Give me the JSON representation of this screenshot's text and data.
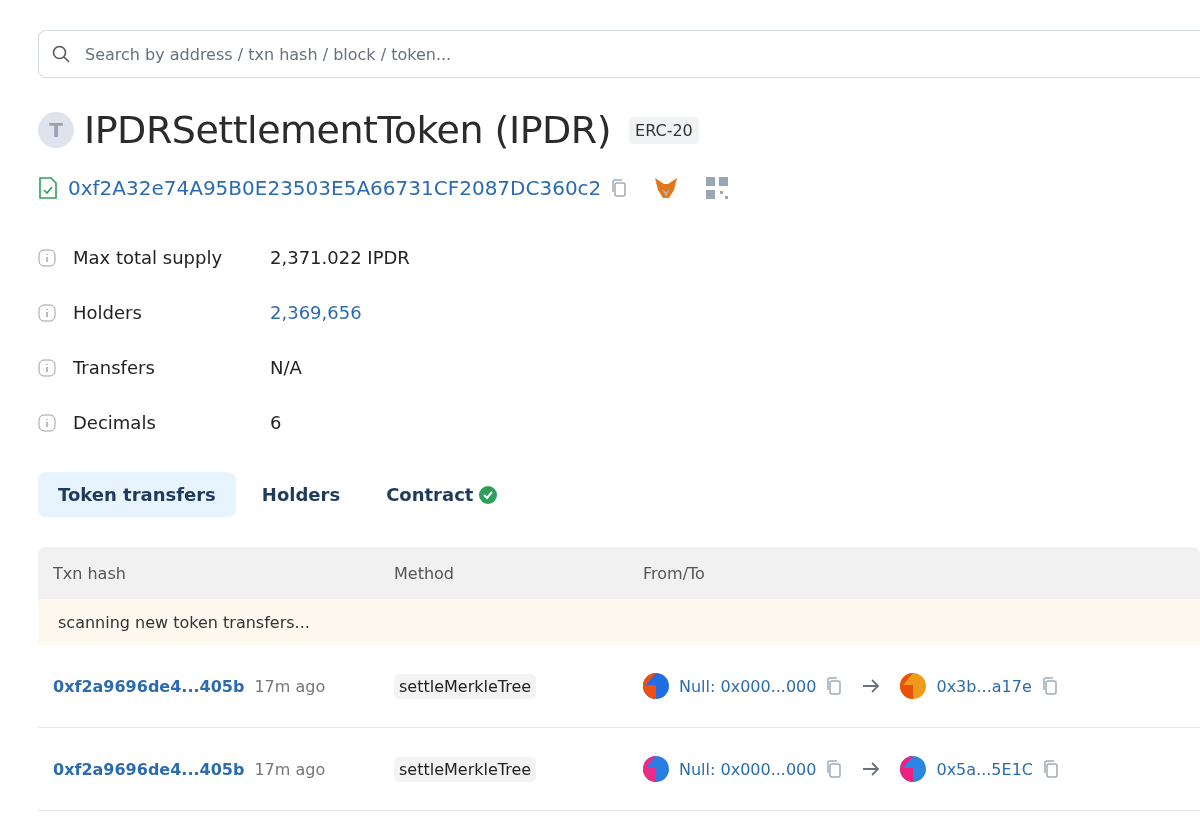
{
  "search": {
    "placeholder": "Search by address / txn hash / block / token..."
  },
  "token": {
    "letter": "T",
    "name": "IPDRSettlementToken (IPDR)",
    "standard": "ERC-20",
    "address": "0xf2A32e74A95B0E23503E5A66731CF2087DC360c2",
    "verified": true
  },
  "details": [
    {
      "label": "Max total supply",
      "value": "2,371.022 IPDR",
      "link": false
    },
    {
      "label": "Holders",
      "value": "2,369,656",
      "link": true
    },
    {
      "label": "Transfers",
      "value": "N/A",
      "link": false
    },
    {
      "label": "Decimals",
      "value": "6",
      "link": false
    }
  ],
  "tabs": [
    {
      "label": "Token transfers",
      "selected": true,
      "verified": false
    },
    {
      "label": "Holders",
      "selected": false,
      "verified": false
    },
    {
      "label": "Contract",
      "selected": false,
      "verified": true
    }
  ],
  "table": {
    "columns": [
      "Txn hash",
      "Method",
      "From/To"
    ],
    "notice": "scanning new token transfers...",
    "rows": [
      {
        "hash": "0xf2a9696de4...405b",
        "age": "17m ago",
        "method": "settleMerkleTree",
        "from": "Null: 0x000...000",
        "to": "0x3b...a17e"
      },
      {
        "hash": "0xf2a9696de4...405b",
        "age": "17m ago",
        "method": "settleMerkleTree",
        "from": "Null: 0x000...000",
        "to": "0x5a...5E1C"
      }
    ]
  }
}
